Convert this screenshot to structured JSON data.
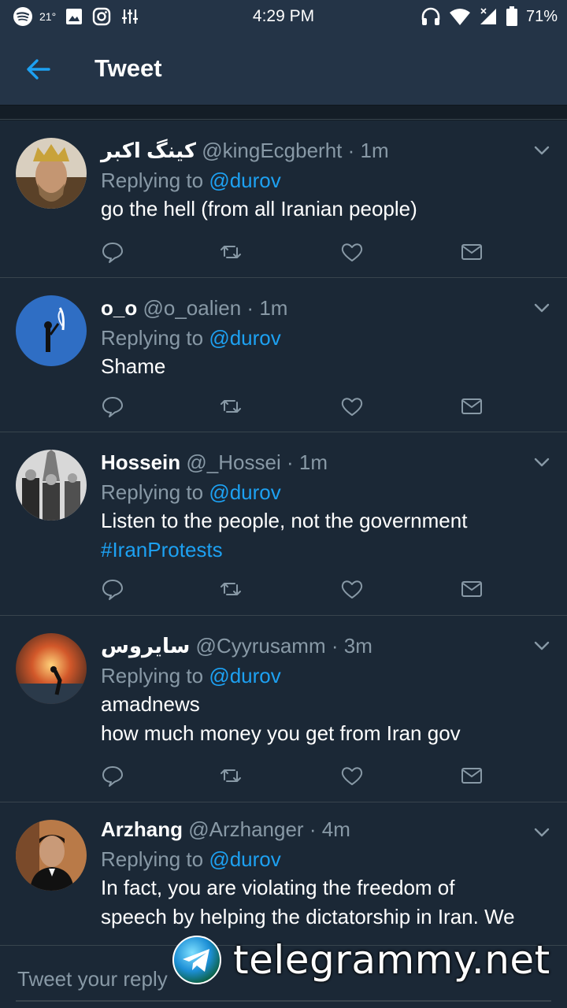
{
  "status_bar": {
    "temperature": "21°",
    "time": "4:29 PM",
    "battery": "71%"
  },
  "app_bar": {
    "title": "Tweet"
  },
  "tweets": [
    {
      "name": "کینگ اکبر",
      "handle": "@kingEcgberht",
      "time": "1m",
      "replying_label": "Replying to",
      "mention": "@durov",
      "text_lines": [
        "go the hell (from all Iranian people)"
      ],
      "hashtag": ""
    },
    {
      "name": "o_o",
      "handle": "@o_oalien",
      "time": "1m",
      "replying_label": "Replying to",
      "mention": "@durov",
      "text_lines": [
        "Shame"
      ],
      "hashtag": ""
    },
    {
      "name": "Hossein",
      "handle": "@_Hossei",
      "time": "1m",
      "replying_label": "Replying to",
      "mention": "@durov",
      "text_lines": [
        "Listen to the people, not the government"
      ],
      "hashtag": "#IranProtests"
    },
    {
      "name": "سایروس",
      "handle": "@Cyyrusamm",
      "time": "3m",
      "replying_label": "Replying to",
      "mention": "@durov",
      "text_lines": [
        "amadnews",
        "how much money you get from Iran gov"
      ],
      "hashtag": ""
    },
    {
      "name": "Arzhang",
      "handle": "@Arzhanger",
      "time": "4m",
      "replying_label": "Replying to",
      "mention": "@durov",
      "text_lines": [
        "In fact, you are violating the freedom of",
        "speech by helping the dictatorship in Iran. We"
      ],
      "hashtag": ""
    }
  ],
  "reply_bar": {
    "placeholder": "Tweet your reply"
  },
  "watermark": {
    "text": "telegrammy.net"
  },
  "icons": {
    "back": "arrow-left-icon",
    "caret": "chevron-down-icon",
    "reply": "comment-icon",
    "retweet": "retweet-icon",
    "like": "heart-icon",
    "dm": "envelope-icon",
    "telegram": "telegram-logo-icon"
  },
  "colors": {
    "accent": "#1da1f2",
    "background": "#141d26",
    "card": "#1b2836",
    "bar": "#243447",
    "muted": "#8899a6"
  }
}
